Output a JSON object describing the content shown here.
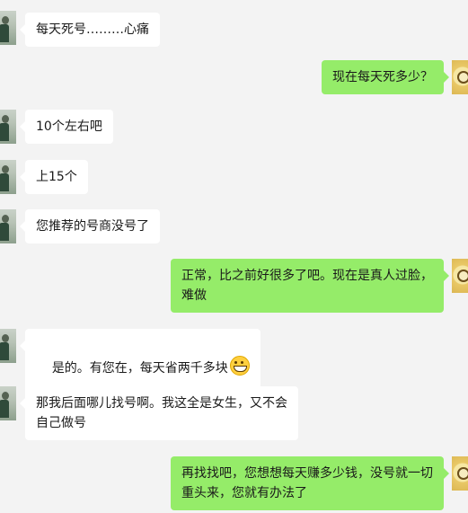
{
  "messages": [
    {
      "side": "left",
      "text": "每天死号………心痛"
    },
    {
      "side": "right",
      "text": "现在每天死多少？"
    },
    {
      "side": "left",
      "text": "10个左右吧"
    },
    {
      "side": "left",
      "text": "上15个"
    },
    {
      "side": "left",
      "text": "您推荐的号商没号了"
    },
    {
      "side": "right",
      "text": "正常，比之前好很多了吧。现在是真人过脸，\n难做"
    },
    {
      "side": "left",
      "text": "是的。有您在，每天省两千多块",
      "emoji": "grin-emoji"
    },
    {
      "side": "left",
      "text": "那我后面哪儿找号啊。我这全是女生，又不会\n自己做号"
    },
    {
      "side": "right",
      "text": "再找找吧，您想想每天赚多少钱，没号就一切\n重头来，您就有办法了"
    }
  ]
}
